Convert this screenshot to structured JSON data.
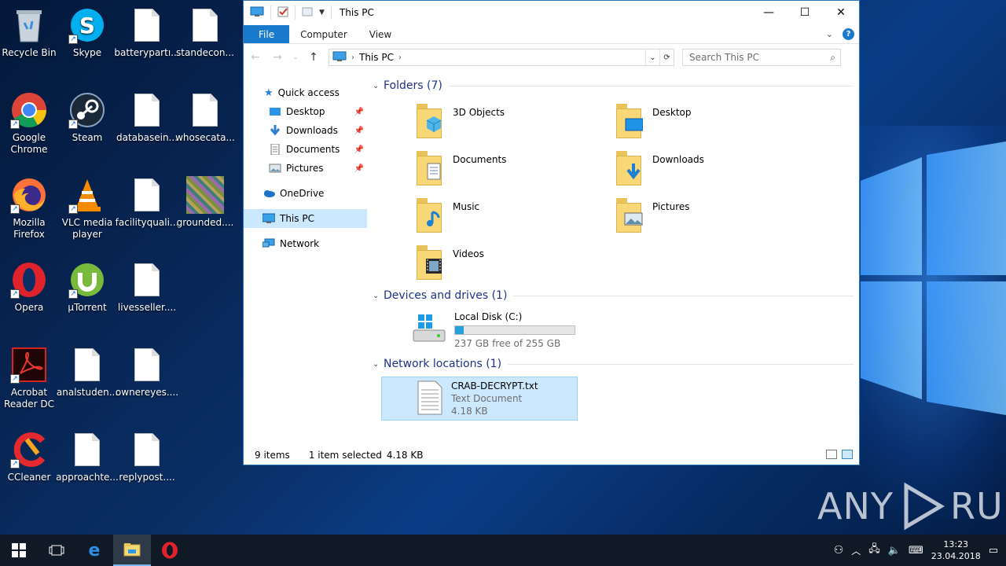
{
  "desktop": {
    "icons": [
      {
        "label": "Recycle Bin"
      },
      {
        "label": "Skype"
      },
      {
        "label": "batterypartı..."
      },
      {
        "label": "standecon..."
      },
      {
        "label": "Google Chrome"
      },
      {
        "label": "Steam"
      },
      {
        "label": "databasein..."
      },
      {
        "label": "whosecata..."
      },
      {
        "label": "Mozilla Firefox"
      },
      {
        "label": "VLC media player"
      },
      {
        "label": "facilityquali..."
      },
      {
        "label": "grounded...."
      },
      {
        "label": "Opera"
      },
      {
        "label": "µTorrent"
      },
      {
        "label": "livesseller...."
      },
      {
        "label": "Acrobat Reader DC"
      },
      {
        "label": "analstuden..."
      },
      {
        "label": "ownereyes...."
      },
      {
        "label": "CCleaner"
      },
      {
        "label": "approachte..."
      },
      {
        "label": "replypost...."
      }
    ]
  },
  "explorer": {
    "title": "This PC",
    "ribbon_tabs": [
      "File",
      "Computer",
      "View"
    ],
    "address": {
      "crumb": "This PC"
    },
    "search_placeholder": "Search This PC",
    "nav": {
      "quick_access": "Quick access",
      "items": [
        "Desktop",
        "Downloads",
        "Documents",
        "Pictures"
      ],
      "onedrive": "OneDrive",
      "this_pc": "This PC",
      "network": "Network"
    },
    "groups": {
      "folders": "Folders (7)",
      "devices": "Devices and drives (1)",
      "network": "Network locations (1)"
    },
    "folders": [
      "3D Objects",
      "Desktop",
      "Documents",
      "Downloads",
      "Music",
      "Pictures",
      "Videos"
    ],
    "drive": {
      "name": "Local Disk (C:)",
      "free": "237 GB free of 255 GB",
      "used_fraction": 0.07
    },
    "network_item": {
      "name": "CRAB-DECRYPT.txt",
      "type": "Text Document",
      "size": "4.18 KB"
    },
    "status": {
      "items": "9 items",
      "selected": "1 item selected",
      "size": "4.18 KB"
    }
  },
  "taskbar": {
    "time": "13:23",
    "date": "23.04.2018"
  },
  "watermark": {
    "left": "ANY",
    "right": "RUN"
  },
  "colors": {
    "accent": "#1979ca",
    "selection": "#cce8ff",
    "folder": "#f8d776"
  }
}
